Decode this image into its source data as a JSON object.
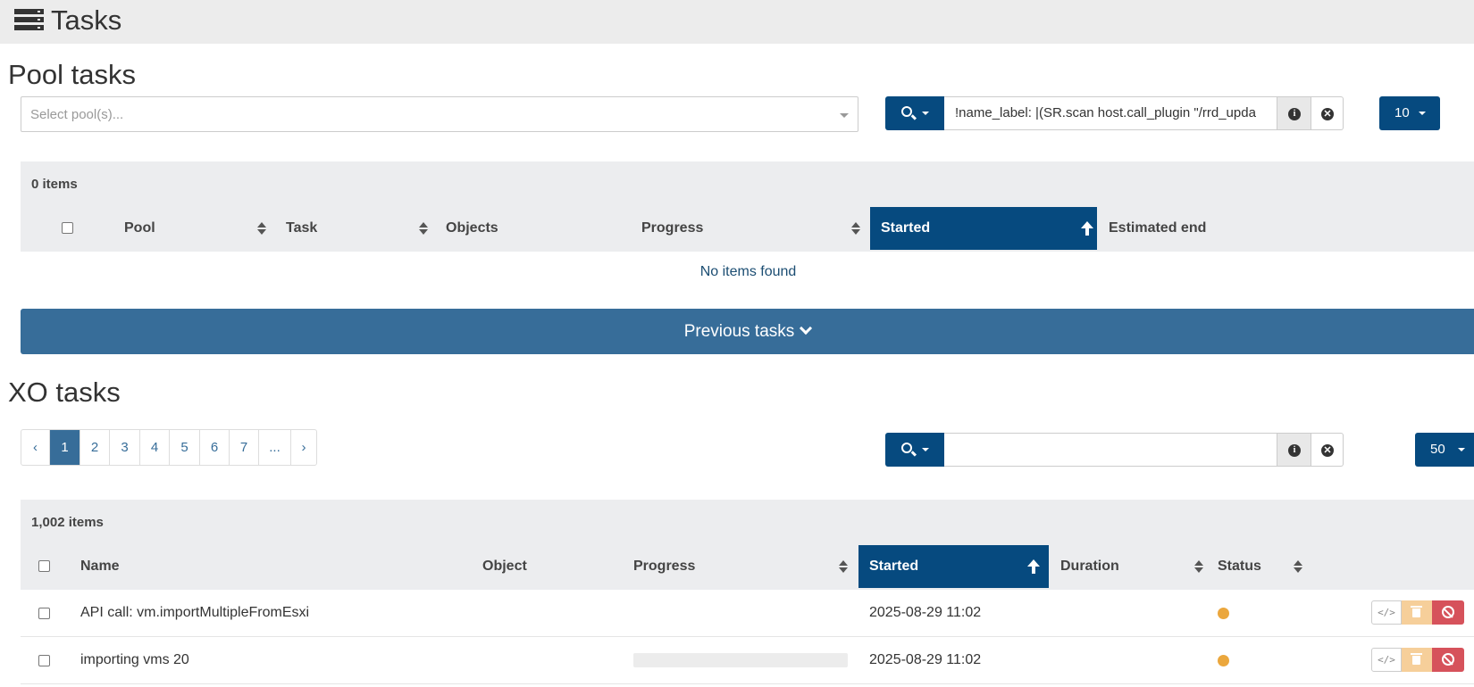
{
  "header": {
    "title": "Tasks",
    "icon": "tasks-icon"
  },
  "pool_tasks": {
    "heading": "Pool tasks",
    "select_placeholder": "Select pool(s)...",
    "search_value": "!name_label: |(SR.scan host.call_plugin \"/rrd_upda",
    "page_size": "10",
    "count_label": "0 items",
    "columns": [
      "Pool",
      "Task",
      "Objects",
      "Progress",
      "Started",
      "Estimated end"
    ],
    "active_sort_column": "Started",
    "empty_text": "No items found",
    "previous_tasks_label": "Previous tasks"
  },
  "xo_tasks": {
    "heading": "XO tasks",
    "pagination": [
      "‹",
      "1",
      "2",
      "3",
      "4",
      "5",
      "6",
      "7",
      "...",
      "›"
    ],
    "current_page": "1",
    "search_value": "",
    "page_size": "50",
    "count_label": "1,002 items",
    "columns": [
      "Name",
      "Object",
      "Progress",
      "Started",
      "Duration",
      "Status"
    ],
    "active_sort_column": "Started",
    "rows": [
      {
        "name": "API call: vm.importMultipleFromEsxi",
        "object": "",
        "progress": "",
        "started": "2025-08-29 11:02",
        "duration": "",
        "status_color": "#eba73d"
      },
      {
        "name": "importing vms 20",
        "object": "",
        "progress": "bar",
        "started": "2025-08-29 11:02",
        "duration": "",
        "status_color": "#eba73d"
      }
    ],
    "row_actions": {
      "code": "</>",
      "delete": "trash-icon",
      "cancel": "ban-icon"
    }
  },
  "colors": {
    "primary": "#064a7f",
    "bar": "#376d99",
    "status_pending": "#eba73d",
    "danger": "#d6525b",
    "warning_light": "#f6cf9a"
  }
}
